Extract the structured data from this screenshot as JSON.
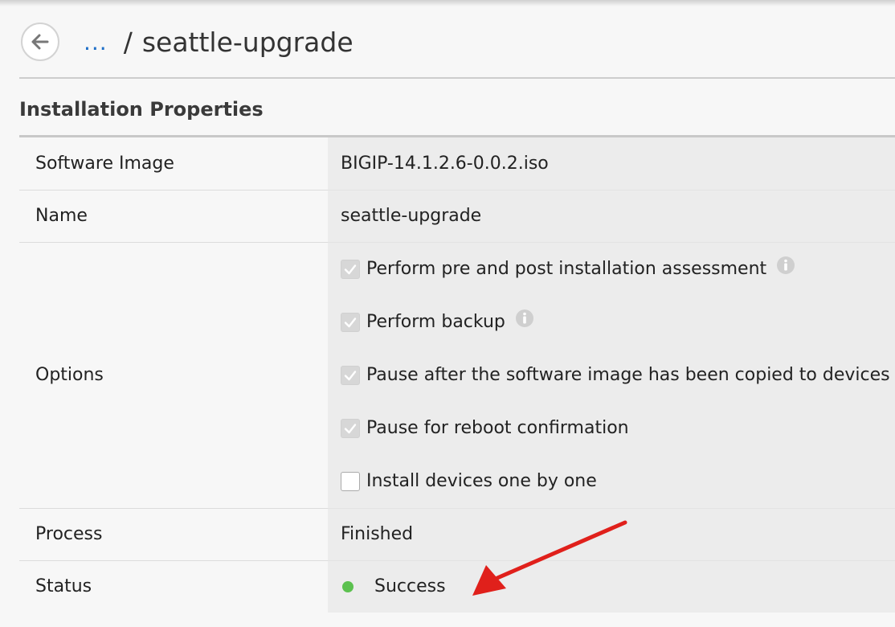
{
  "header": {
    "back_icon": "arrow-left-icon",
    "breadcrumb_link": "...",
    "breadcrumb_separator": "/",
    "title": "seattle-upgrade"
  },
  "section": {
    "title": "Installation Properties"
  },
  "properties": {
    "software_image": {
      "label": "Software Image",
      "value": "BIGIP-14.1.2.6-0.0.2.iso"
    },
    "name": {
      "label": "Name",
      "value": "seattle-upgrade"
    },
    "options": {
      "label": "Options",
      "items": [
        {
          "label": "Perform pre and post installation assessment",
          "checked": true,
          "info": true
        },
        {
          "label": "Perform backup",
          "checked": true,
          "info": true
        },
        {
          "label": "Pause after the software image has been copied to devices",
          "checked": true,
          "info": false
        },
        {
          "label": "Pause for reboot confirmation",
          "checked": true,
          "info": false
        },
        {
          "label": "Install devices one by one",
          "checked": false,
          "info": false
        }
      ]
    },
    "process": {
      "label": "Process",
      "value": "Finished"
    },
    "status": {
      "label": "Status",
      "value": "Success",
      "color": "#5cc14f"
    }
  },
  "annotation": {
    "color": "#e0201b"
  }
}
